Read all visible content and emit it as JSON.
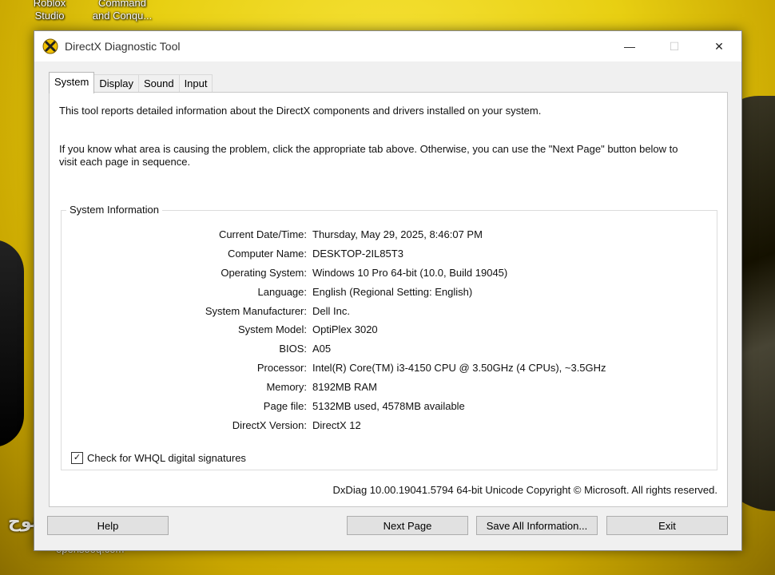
{
  "desktop": {
    "icons": [
      {
        "label": "Roblox\nStudio"
      },
      {
        "label": "Command\nand Conqu..."
      }
    ],
    "watermark_ar": "السوق المفتوح",
    "watermark_en": "opensooq.com"
  },
  "window": {
    "title": "DirectX Diagnostic Tool",
    "controls": {
      "minimize": "—",
      "maximize": "☐",
      "close": "✕"
    }
  },
  "tabs": [
    {
      "label": "System"
    },
    {
      "label": "Display"
    },
    {
      "label": "Sound"
    },
    {
      "label": "Input"
    }
  ],
  "intro": {
    "line1": "This tool reports detailed information about the DirectX components and drivers installed on your system.",
    "line2": "If you know what area is causing the problem, click the appropriate tab above.  Otherwise, you can use the \"Next Page\" button below to",
    "line3": "visit each page in sequence."
  },
  "system_info": {
    "title": "System Information",
    "rows": [
      {
        "label": "Current Date/Time:",
        "value": "Thursday, May 29, 2025, 8:46:07 PM"
      },
      {
        "label": "Computer Name:",
        "value": "DESKTOP-2IL85T3"
      },
      {
        "label": "Operating System:",
        "value": "Windows 10 Pro 64-bit (10.0, Build 19045)"
      },
      {
        "label": "Language:",
        "value": "English (Regional Setting: English)"
      },
      {
        "label": "System Manufacturer:",
        "value": "Dell Inc."
      },
      {
        "label": "System Model:",
        "value": "OptiPlex 3020"
      },
      {
        "label": "BIOS:",
        "value": "A05"
      },
      {
        "label": "Processor:",
        "value": "Intel(R) Core(TM) i3-4150 CPU @ 3.50GHz (4 CPUs), ~3.5GHz"
      },
      {
        "label": "Memory:",
        "value": "8192MB RAM"
      },
      {
        "label": "Page file:",
        "value": "5132MB used, 4578MB available"
      },
      {
        "label": "DirectX Version:",
        "value": "DirectX 12"
      }
    ],
    "whql_label": "Check for WHQL digital signatures",
    "whql_checked": true
  },
  "footer": {
    "version_line": "DxDiag 10.00.19041.5794 64-bit Unicode  Copyright © Microsoft. All rights reserved."
  },
  "buttons": {
    "help": "Help",
    "next_page": "Next Page",
    "save_all": "Save All Information...",
    "exit": "Exit"
  }
}
